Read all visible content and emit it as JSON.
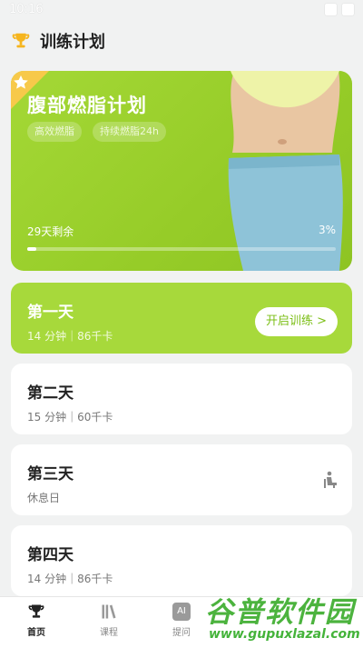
{
  "status_bar": {
    "time": "10:16"
  },
  "header": {
    "title": "训练计划",
    "icon": "trophy-icon"
  },
  "banner": {
    "title": "腹部燃脂计划",
    "tags": [
      "高效燃脂",
      "持续燃脂24h"
    ],
    "remaining": "29天剩余",
    "percent_label": "3%",
    "progress": 0.03,
    "accent": "#9ed132"
  },
  "days": [
    {
      "title": "第一天",
      "sub": "14 分钟｜86千卡",
      "button": "开启训练 >"
    },
    {
      "title": "第二天",
      "sub": "15 分钟｜60千卡"
    },
    {
      "title": "第三天",
      "sub": "休息日",
      "icon": "resting-person-icon"
    },
    {
      "title": "第四天",
      "sub": "14 分钟｜86千卡"
    }
  ],
  "tabbar": {
    "items": [
      {
        "label": "首页",
        "icon": "trophy-icon"
      },
      {
        "label": "课程",
        "icon": "books-icon"
      },
      {
        "label": "提问",
        "icon": "ai-icon",
        "icon_text": "AI"
      }
    ]
  },
  "watermark": {
    "main": "谷普软件园",
    "url": "www.gupuxlazal.com"
  }
}
